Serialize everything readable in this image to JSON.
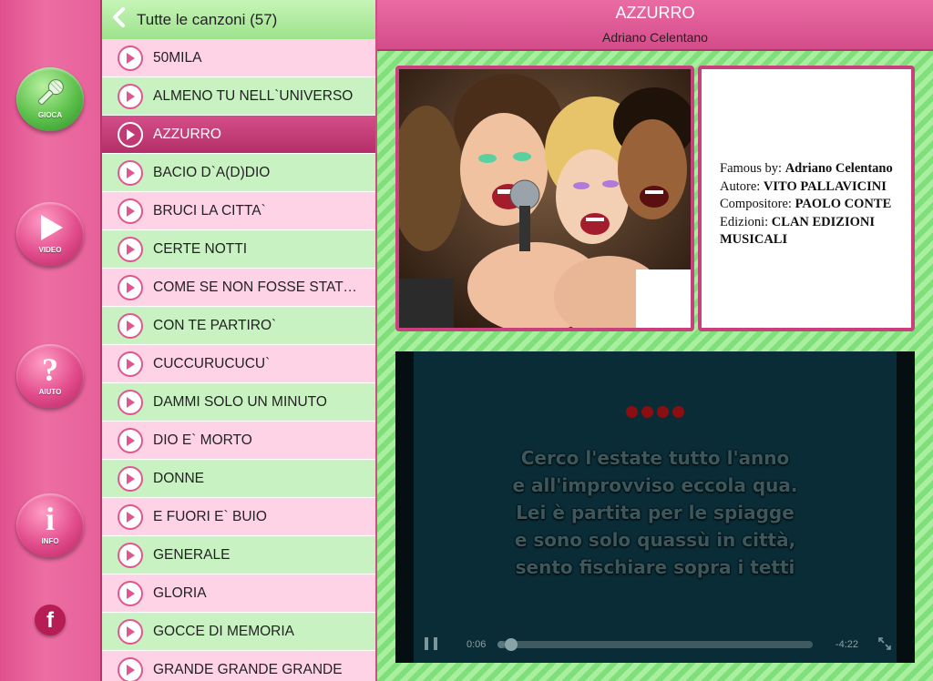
{
  "sidebar": {
    "buttons": [
      {
        "label": "GIOCA",
        "icon": "microphone-icon",
        "color": "#5bc04a"
      },
      {
        "label": "VIDEO",
        "icon": "play-icon",
        "color": "#e24c8c"
      },
      {
        "label": "AIUTO",
        "icon": "question-icon",
        "color": "#e24c8c"
      },
      {
        "label": "INFO",
        "icon": "info-icon",
        "color": "#e24c8c"
      }
    ],
    "facebook": "f"
  },
  "list": {
    "title": "Tutte le canzoni (57)",
    "songs": [
      {
        "name": "50MILA",
        "style": "pink"
      },
      {
        "name": "ALMENO TU NELL`UNIVERSO",
        "style": "green"
      },
      {
        "name": "AZZURRO",
        "style": "selected"
      },
      {
        "name": "BACIO D`A(D)DIO",
        "style": "green"
      },
      {
        "name": "BRUCI LA CITTA`",
        "style": "pink"
      },
      {
        "name": "CERTE NOTTI",
        "style": "green"
      },
      {
        "name": "COME SE NON FOSSE STATO MAI AMORE",
        "style": "pink"
      },
      {
        "name": "CON TE PARTIRO`",
        "style": "green"
      },
      {
        "name": "CUCCURUCUCU`",
        "style": "pink"
      },
      {
        "name": "DAMMI SOLO UN MINUTO",
        "style": "green"
      },
      {
        "name": "DIO E` MORTO",
        "style": "pink"
      },
      {
        "name": "DONNE",
        "style": "green"
      },
      {
        "name": "E FUORI E` BUIO",
        "style": "pink"
      },
      {
        "name": "GENERALE",
        "style": "green"
      },
      {
        "name": "GLORIA",
        "style": "pink"
      },
      {
        "name": "GOCCE DI MEMORIA",
        "style": "green"
      },
      {
        "name": "GRANDE GRANDE GRANDE",
        "style": "pink"
      }
    ]
  },
  "header": {
    "title": "AZZURRO",
    "artist": "Adriano Celentano"
  },
  "info_card": {
    "famous_label": "Famous by:",
    "famous_value": "Adriano Celentano",
    "author_label": "Autore:",
    "author_value": "VITO PALLAVICINI",
    "composer_label": "Compositore:",
    "composer_value": "PAOLO CONTE",
    "editions_label": "Edizioni:",
    "editions_value": "CLAN EDIZIONI MUSICALI"
  },
  "video": {
    "countdown_dots": 4,
    "lyrics": [
      "Cerco l'estate tutto l'anno",
      "e all'improvviso eccola qua.",
      "Lei è partita per le spiagge",
      "e sono solo quassù in città,",
      "sento fischiare sopra i tetti"
    ],
    "time_elapsed": "0:06",
    "time_remaining": "-4:22",
    "progress": 0.024
  },
  "colors": {
    "accent_pink": "#d44c8a",
    "list_green": "#c9f2c2",
    "list_pink": "#ffd3e6",
    "video_bg": "#0a2c36"
  }
}
